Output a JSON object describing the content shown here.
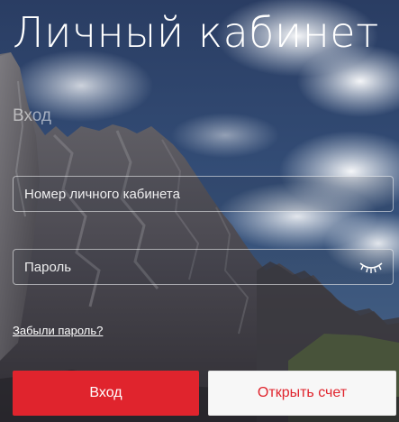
{
  "page": {
    "title": "Личный кабинет",
    "subtitle": "Вход"
  },
  "form": {
    "account_placeholder": "Номер личного кабинета",
    "account_value": "",
    "password_placeholder": "Пароль",
    "password_value": "",
    "show_password_icon": "eye-closed-icon",
    "forgot_link": "Забыли пароль?"
  },
  "actions": {
    "login_label": "Вход",
    "open_account_label": "Открыть счет"
  },
  "colors": {
    "accent": "#e0242d",
    "secondary_button_bg": "#f7f7f7",
    "text_on_image": "#ffffff"
  }
}
